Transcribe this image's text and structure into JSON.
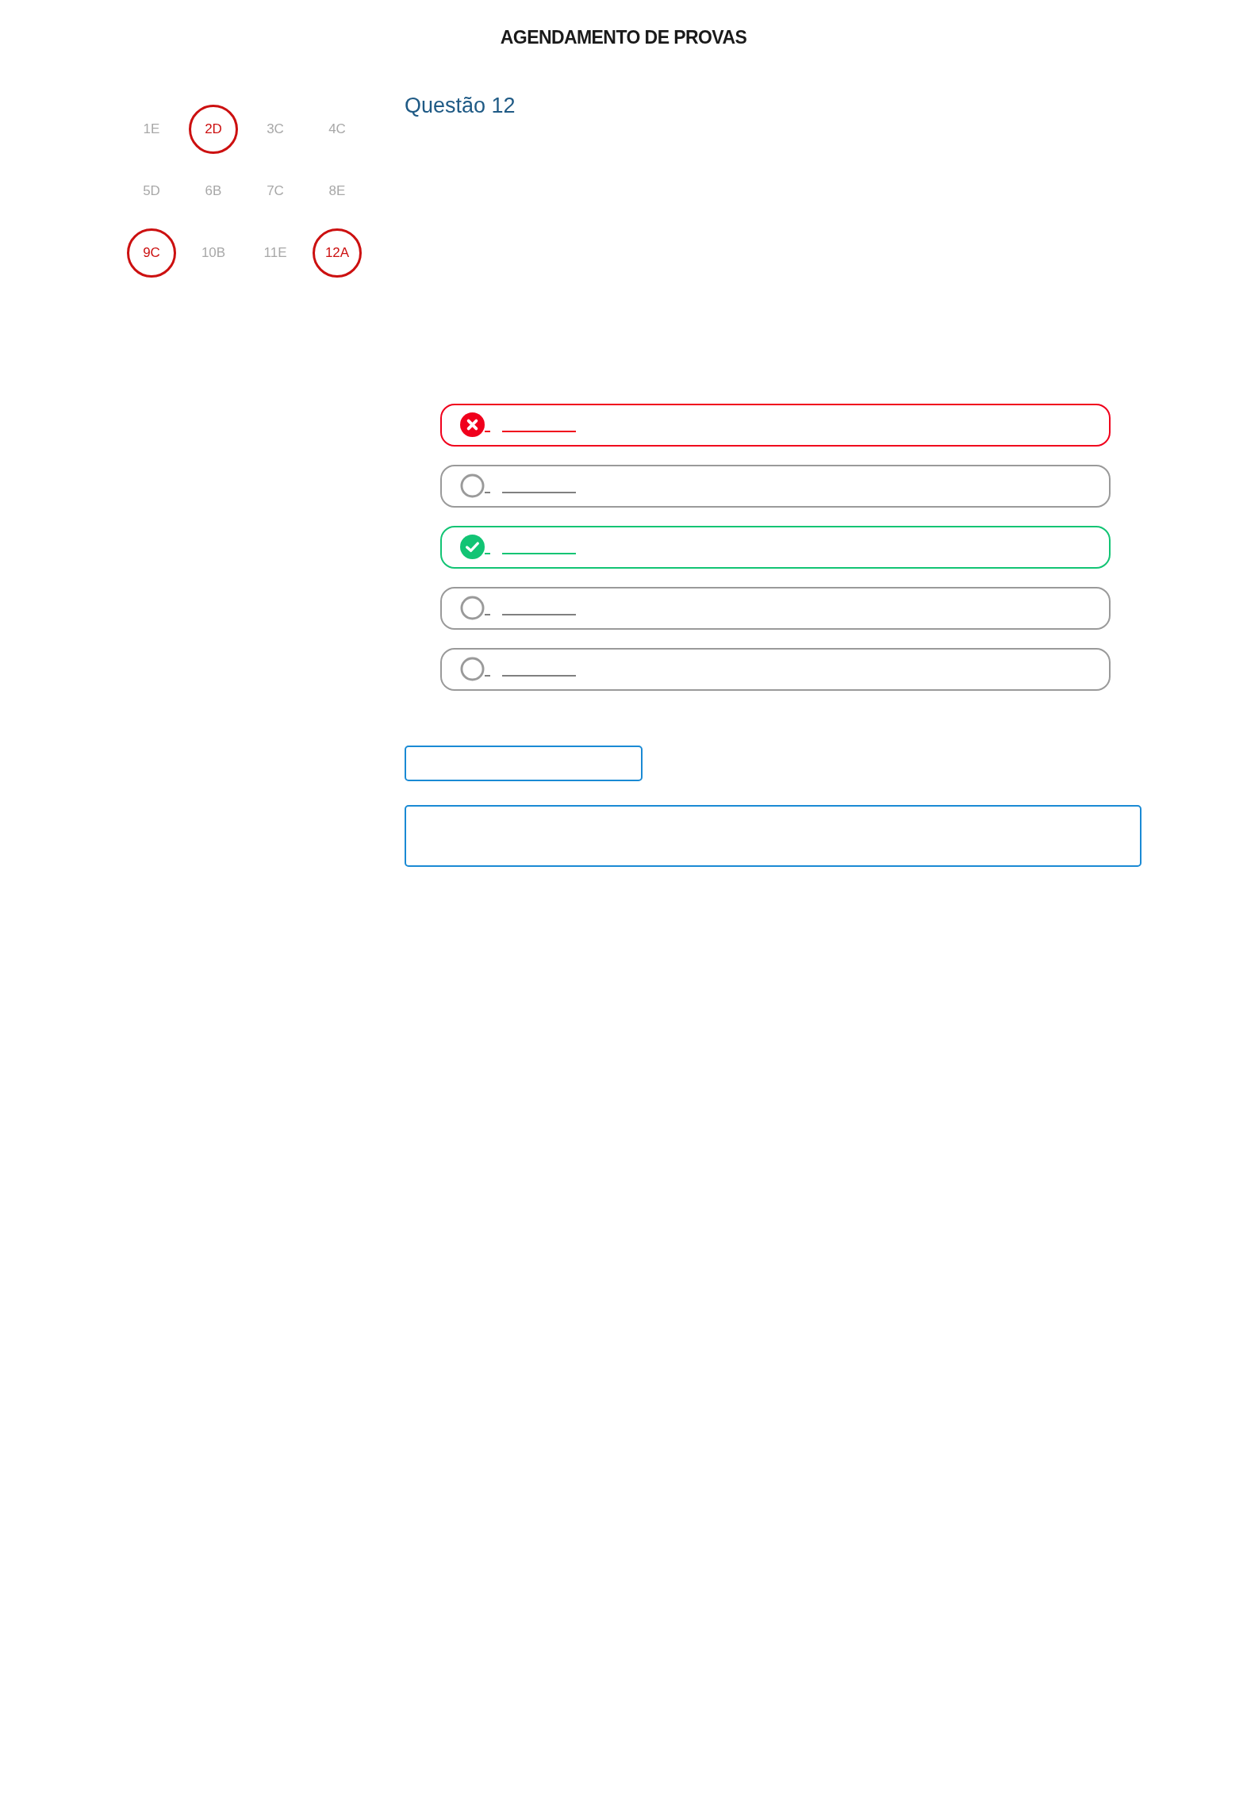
{
  "header": {
    "title": "AGENDAMENTO DE PROVAS"
  },
  "question_nav": [
    {
      "label": "1E",
      "flagged": false
    },
    {
      "label": "2D",
      "flagged": true
    },
    {
      "label": "3C",
      "flagged": false
    },
    {
      "label": "4C",
      "flagged": false
    },
    {
      "label": "5D",
      "flagged": false
    },
    {
      "label": "6B",
      "flagged": false
    },
    {
      "label": "7C",
      "flagged": false
    },
    {
      "label": "8E",
      "flagged": false
    },
    {
      "label": "9C",
      "flagged": true
    },
    {
      "label": "10B",
      "flagged": false
    },
    {
      "label": "11E",
      "flagged": false
    },
    {
      "label": "12A",
      "flagged": true
    }
  ],
  "question": {
    "title": "Questão 12"
  },
  "options": [
    {
      "kind": "wrong"
    },
    {
      "kind": "neutral"
    },
    {
      "kind": "correct"
    },
    {
      "kind": "neutral"
    },
    {
      "kind": "neutral"
    }
  ]
}
